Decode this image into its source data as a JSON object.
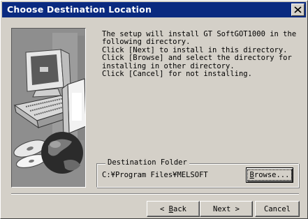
{
  "window": {
    "title": "Choose Destination Location",
    "close_glyph": "X"
  },
  "description": {
    "lines": [
      "The setup will install GT SoftGOT1000 in the",
      "following directory.",
      "Click [Next] to install in this directory.",
      "Click [Browse] and select the directory for",
      "installing in other directory.",
      "Click [Cancel] for not installing."
    ]
  },
  "destination": {
    "group_label": "Destination Folder",
    "path": "C:¥Program Files¥MELSOFT",
    "browse_label": "Browse...",
    "browse_mnemonic": "B",
    "browse_rest": "rowse..."
  },
  "buttons": {
    "back_prefix": "< ",
    "back_mnemonic": "B",
    "back_rest": "ack",
    "next_label": "Next >",
    "cancel_label": "Cancel"
  },
  "icons": {
    "close": "close-icon",
    "illustration": "computer-setup-illustration"
  },
  "colors": {
    "titlebar": "#0a2a80",
    "face": "#d4d0c8",
    "art_bg": "#8e8e8e"
  }
}
